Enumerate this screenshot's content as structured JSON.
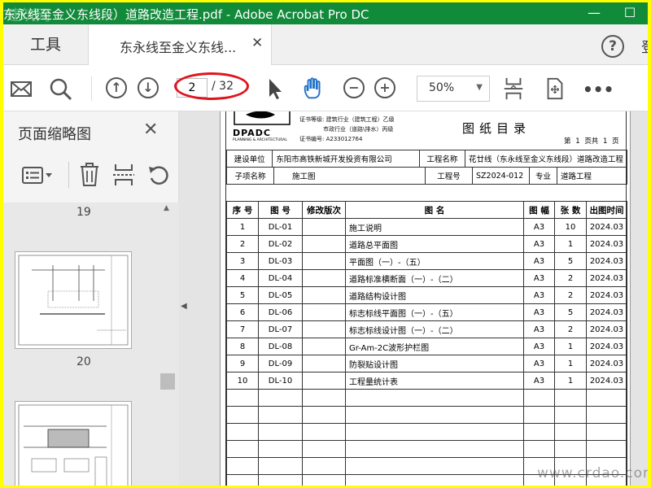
{
  "window": {
    "title": "东永线至金义东线段）道路改造工程.pdf - Adobe Acrobat Pro DC",
    "watermark": "建筑网"
  },
  "tabs": {
    "tools_label": "工具",
    "doc_tab_label": "东永线至金义东线...",
    "sign_in_partial": "登"
  },
  "toolbar": {
    "page_current": "2",
    "page_total": "/ 32",
    "zoom": "50%"
  },
  "left_panel": {
    "title": "页面缩略图",
    "page_labels": [
      "19",
      "20"
    ]
  },
  "document": {
    "certificate": {
      "logo_text": "DPADC",
      "logo_subtext": "PLANNING & ARCHITECTURAL",
      "line1": "证书等级: 建筑行业（建筑工程）乙级",
      "line2": "市政行业（道路\\排水）丙级",
      "line3": "证书编号: A233012764"
    },
    "sheet_title": "图纸目录",
    "sheet_page": "第 1 页共 1 页",
    "info": {
      "build_unit_label": "建设单位",
      "build_unit_value": "东阳市高铁新城开发投资有限公司",
      "project_name_label": "工程名称",
      "project_name_value": "花廿线（东永线至金义东线段）道路改造工程",
      "subproject_label": "子项名称",
      "subproject_value": "施工图",
      "project_no_label": "工程号",
      "project_no_value": "SZ2024-012",
      "discipline_label": "专业",
      "discipline_value": "道路工程"
    },
    "table": {
      "headers": [
        "序 号",
        "图 号",
        "修改版次",
        "图 名",
        "图 幅",
        "张 数",
        "出图时间"
      ],
      "rows": [
        [
          "1",
          "DL-01",
          "",
          "施工说明",
          "A3",
          "10",
          "2024.03"
        ],
        [
          "2",
          "DL-02",
          "",
          "道路总平面图",
          "A3",
          "1",
          "2024.03"
        ],
        [
          "3",
          "DL-03",
          "",
          "平面图（一）-（五）",
          "A3",
          "5",
          "2024.03"
        ],
        [
          "4",
          "DL-04",
          "",
          "道路标准横断面（一）-（二）",
          "A3",
          "2",
          "2024.03"
        ],
        [
          "5",
          "DL-05",
          "",
          "道路结构设计图",
          "A3",
          "2",
          "2024.03"
        ],
        [
          "6",
          "DL-06",
          "",
          "标志标线平面图（一）-（五）",
          "A3",
          "5",
          "2024.03"
        ],
        [
          "7",
          "DL-07",
          "",
          "标志标线设计图（一）-（二）",
          "A3",
          "2",
          "2024.03"
        ],
        [
          "8",
          "DL-08",
          "",
          "Gr-Am-2C波形护栏图",
          "A3",
          "1",
          "2024.03"
        ],
        [
          "9",
          "DL-09",
          "",
          "防裂贴设计图",
          "A3",
          "1",
          "2024.03"
        ],
        [
          "10",
          "DL-10",
          "",
          "工程量统计表",
          "A3",
          "1",
          "2024.03"
        ]
      ],
      "empty_rows": 6
    }
  },
  "footer_watermark": "www.crdao.com"
}
